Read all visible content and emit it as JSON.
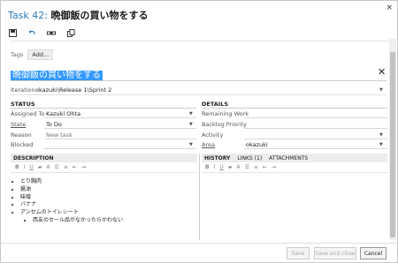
{
  "dialog": {
    "task_id": "Task 42:",
    "task_title": "晩御飯の買い物をする",
    "close": "×"
  },
  "toolbar": {
    "icons": [
      "save-icon",
      "undo-icon",
      "link-icon",
      "copy-icon"
    ]
  },
  "tags": {
    "label": "Tags",
    "add": "Add..."
  },
  "work_title": "晩御飯の買い物をする",
  "iteration": {
    "label": "Iteration",
    "value": "okazuki\\Release 1\\Sprint 2"
  },
  "status": {
    "header": "STATUS",
    "fields": [
      {
        "label": "Assigned To",
        "value": "Kazuki Ohta"
      },
      {
        "label": "State",
        "value": "To Do"
      },
      {
        "label": "Reason",
        "value": "New task"
      },
      {
        "label": "Blocked",
        "value": ""
      }
    ]
  },
  "details": {
    "header": "DETAILS",
    "fields": [
      {
        "label": "Remaining Work",
        "value": ""
      },
      {
        "label": "Backlog Priority",
        "value": ""
      },
      {
        "label": "Activity",
        "value": ""
      },
      {
        "label": "Area",
        "value": "okazuki"
      }
    ]
  },
  "description": {
    "header": "DESCRIPTION",
    "items": [
      "とり胸肉",
      "醤油",
      "味噌",
      "バナナ",
      "アンセムのトイレシート"
    ],
    "subitems": [
      "西友のセール品がなかったらかわない"
    ]
  },
  "history_tabs": [
    "HISTORY",
    "LINKS (1)",
    "ATTACHMENTS"
  ],
  "buttons": {
    "save": "Save",
    "save_close": "Save and close",
    "cancel": "Cancel"
  },
  "colors": {
    "accent": "#2b7bb9",
    "selection": "#3399ff"
  }
}
